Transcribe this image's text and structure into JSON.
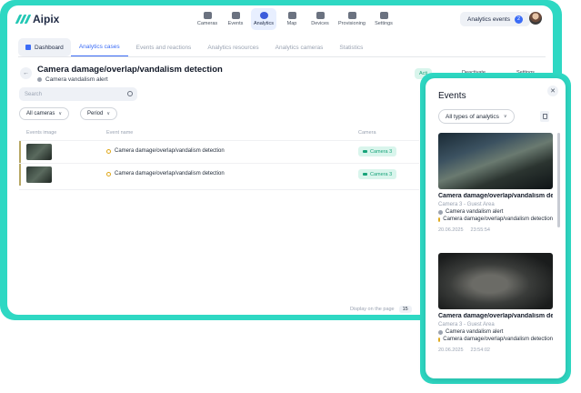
{
  "app": {
    "logo": "Aipix"
  },
  "nav": [
    {
      "label": "Cameras",
      "icon": "camera-icon"
    },
    {
      "label": "Events",
      "icon": "events-icon"
    },
    {
      "label": "Analytics",
      "icon": "analytics-icon"
    },
    {
      "label": "Map",
      "icon": "map-pin-icon"
    },
    {
      "label": "Devices",
      "icon": "devices-icon"
    },
    {
      "label": "Provisioning",
      "icon": "provisioning-icon"
    },
    {
      "label": "Settings",
      "icon": "gear-icon"
    }
  ],
  "header": {
    "analytics_events_label": "Analytics events",
    "analytics_events_count": "2"
  },
  "tabs": [
    "Dashboard",
    "Analytics cases",
    "Events and reactions",
    "Analytics resources",
    "Analytics cameras",
    "Statistics"
  ],
  "page": {
    "title": "Camera damage/overlap/vandalism detection",
    "subtitle": "Camera vandalism alert",
    "action_label": "Acti",
    "header_fragments": [
      "Deactivate",
      "Settings"
    ]
  },
  "search": {
    "placeholder": "Search"
  },
  "filters": {
    "cameras": "All cameras",
    "period": "Period"
  },
  "table": {
    "headers": [
      "Events image",
      "Event name",
      "Camera"
    ],
    "rows": [
      {
        "name": "Camera damage/overlap/vandalism detection",
        "camera": "Camera 3"
      },
      {
        "name": "Camera damage/overlap/vandalism detection",
        "camera": "Camera 3"
      }
    ]
  },
  "pager": {
    "label": "Display on the page",
    "value": "15"
  },
  "panel": {
    "title": "Events",
    "filter": "All types of analytics",
    "cards": [
      {
        "title": "Camera damage/overlap/vandalism detection",
        "camera": "Camera 3 - Guest Area",
        "line1": "Camera vandalism alert",
        "line2": "Camera damage/overlap/vandalism detection",
        "date": "20.06.2025",
        "time": "23:55:54"
      },
      {
        "title": "Camera damage/overlap/vandalism detection",
        "camera": "Camera 3 - Guest Area",
        "line1": "Camera vandalism alert",
        "line2": "Camera damage/overlap/vandalism detection",
        "date": "20.06.2025",
        "time": "23:54:02"
      }
    ]
  }
}
